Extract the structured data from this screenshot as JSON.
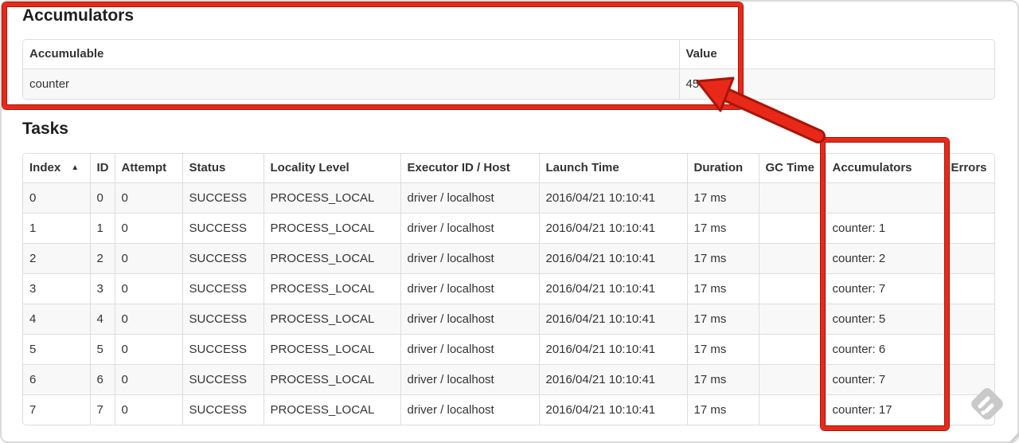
{
  "accumulators": {
    "title": "Accumulators",
    "headers": [
      "Accumulable",
      "Value"
    ],
    "rows": [
      {
        "name": "counter",
        "value": "45"
      }
    ]
  },
  "tasks": {
    "title": "Tasks",
    "sort_icon": "▲",
    "sorted_column": "Index",
    "headers": [
      "Index",
      "ID",
      "Attempt",
      "Status",
      "Locality Level",
      "Executor ID / Host",
      "Launch Time",
      "Duration",
      "GC Time",
      "Accumulators",
      "Errors"
    ],
    "rows": [
      [
        "0",
        "0",
        "0",
        "SUCCESS",
        "PROCESS_LOCAL",
        "driver / localhost",
        "2016/04/21 10:10:41",
        "17 ms",
        "",
        "",
        ""
      ],
      [
        "1",
        "1",
        "0",
        "SUCCESS",
        "PROCESS_LOCAL",
        "driver / localhost",
        "2016/04/21 10:10:41",
        "17 ms",
        "",
        "counter: 1",
        ""
      ],
      [
        "2",
        "2",
        "0",
        "SUCCESS",
        "PROCESS_LOCAL",
        "driver / localhost",
        "2016/04/21 10:10:41",
        "17 ms",
        "",
        "counter: 2",
        ""
      ],
      [
        "3",
        "3",
        "0",
        "SUCCESS",
        "PROCESS_LOCAL",
        "driver / localhost",
        "2016/04/21 10:10:41",
        "17 ms",
        "",
        "counter: 7",
        ""
      ],
      [
        "4",
        "4",
        "0",
        "SUCCESS",
        "PROCESS_LOCAL",
        "driver / localhost",
        "2016/04/21 10:10:41",
        "17 ms",
        "",
        "counter: 5",
        ""
      ],
      [
        "5",
        "5",
        "0",
        "SUCCESS",
        "PROCESS_LOCAL",
        "driver / localhost",
        "2016/04/21 10:10:41",
        "17 ms",
        "",
        "counter: 6",
        ""
      ],
      [
        "6",
        "6",
        "0",
        "SUCCESS",
        "PROCESS_LOCAL",
        "driver / localhost",
        "2016/04/21 10:10:41",
        "17 ms",
        "",
        "counter: 7",
        ""
      ],
      [
        "7",
        "7",
        "0",
        "SUCCESS",
        "PROCESS_LOCAL",
        "driver / localhost",
        "2016/04/21 10:10:41",
        "17 ms",
        "",
        "counter: 17",
        ""
      ]
    ]
  },
  "annotations": {
    "highlight_color": "#e8291a",
    "highlight_edge_color": "#a81408",
    "watermark_color": "#c9c9c9"
  }
}
